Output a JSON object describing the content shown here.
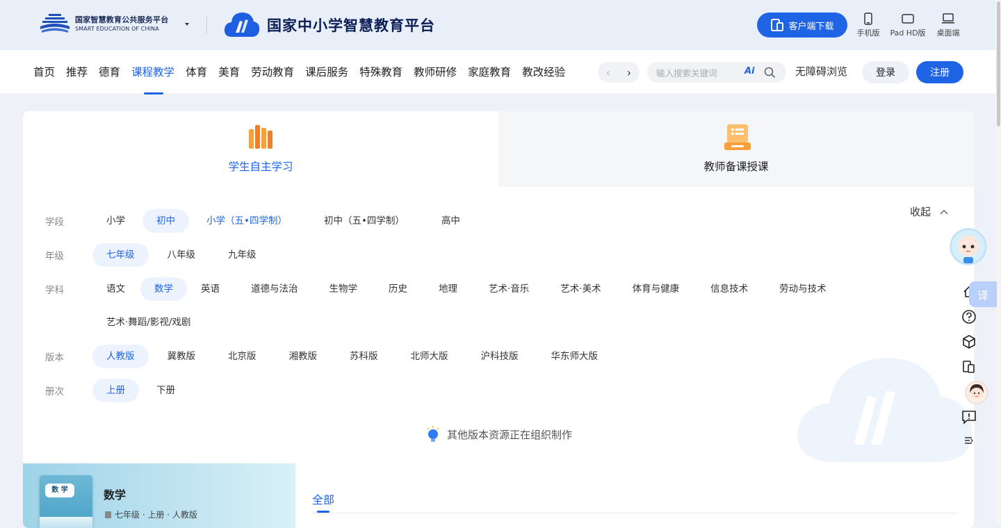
{
  "header": {
    "org_logo_cn": "国家智慧教育公共服务平台",
    "org_logo_en": "SMART EDUCATION OF CHINA",
    "brand_title": "国家中小学智慧教育平台",
    "download_button": "客户端下载",
    "devices": [
      "手机版",
      "Pad HD版",
      "桌面端"
    ]
  },
  "nav": {
    "items": [
      "首页",
      "推荐",
      "德育",
      "课程教学",
      "体育",
      "美育",
      "劳动教育",
      "课后服务",
      "特殊教育",
      "教师研修",
      "家庭教育",
      "教改经验"
    ],
    "active": "课程教学",
    "search_placeholder": "输入搜索关键词",
    "ai_label": "Ai",
    "accessibility": "无障碍浏览",
    "login": "登录",
    "register": "注册"
  },
  "tabs": {
    "student": "学生自主学习",
    "teacher": "教师备课授课"
  },
  "filters": {
    "collapse": "收起",
    "stage": {
      "label": "学段",
      "options": [
        "小学",
        "初中",
        "小学（五•四学制）",
        "初中（五•四学制）",
        "高中"
      ],
      "selected": "初中"
    },
    "grade": {
      "label": "年级",
      "options": [
        "七年级",
        "八年级",
        "九年级"
      ],
      "selected": "七年级"
    },
    "subject": {
      "label": "学科",
      "options": [
        "语文",
        "数学",
        "英语",
        "道德与法治",
        "生物学",
        "历史",
        "地理",
        "艺术·音乐",
        "艺术·美术",
        "体育与健康",
        "信息技术",
        "劳动与技术"
      ],
      "extra": "艺术·舞蹈/影视/戏剧",
      "selected": "数学"
    },
    "edition": {
      "label": "版本",
      "options": [
        "人教版",
        "冀教版",
        "北京版",
        "湘教版",
        "苏科版",
        "北师大版",
        "沪科技版",
        "华东师大版"
      ],
      "selected": "人教版"
    },
    "volume": {
      "label": "册次",
      "options": [
        "上册",
        "下册"
      ],
      "selected": "上册"
    }
  },
  "notice": "其他版本资源正在组织制作",
  "book": {
    "title": "数学",
    "meta": "七年级 · 上册 · 人教版",
    "cover_label": "数 学"
  },
  "content_tabs": {
    "all": "全部"
  },
  "side_tools": {
    "translate": "译"
  },
  "colors": {
    "primary": "#1f64e4",
    "selected_bg": "#edf3fe",
    "header_bg": "#e9eff9"
  }
}
